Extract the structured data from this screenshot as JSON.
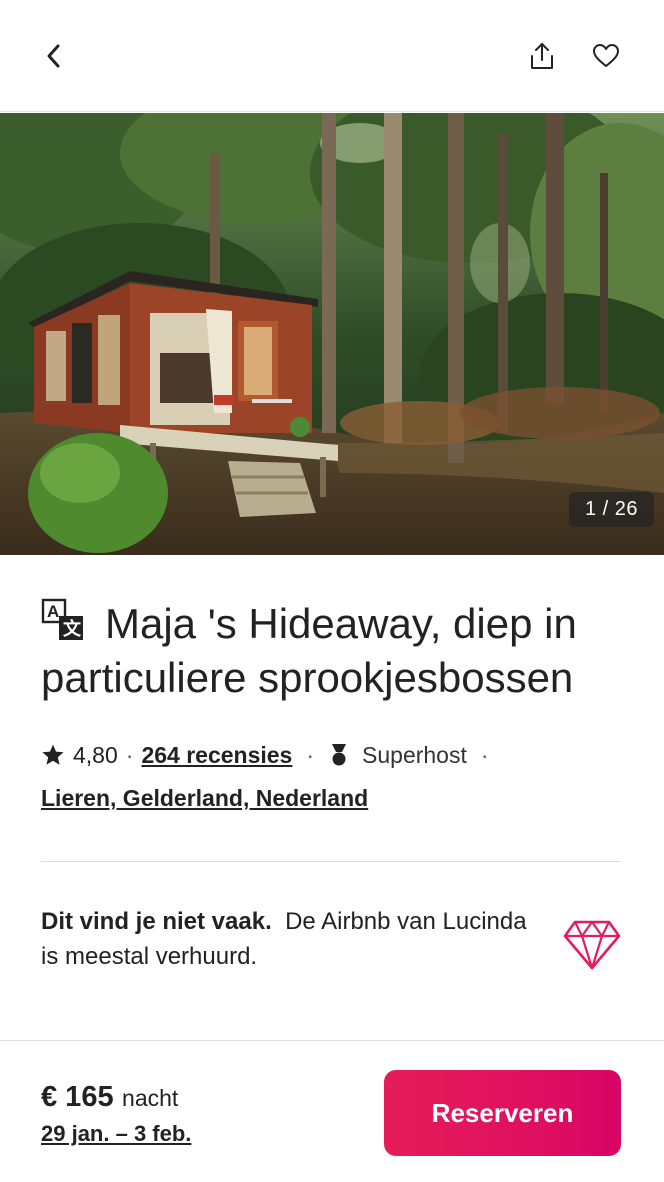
{
  "header": {
    "back_icon": "chevron-left-icon",
    "share_icon": "share-icon",
    "save_icon": "heart-icon"
  },
  "gallery": {
    "counter": "1 / 26",
    "image_description": "tiny-cabin-in-forest"
  },
  "listing": {
    "title": "Maja 's Hideaway, diep in particuliere sprookjesbossen",
    "translate_icon": "translate-icon",
    "rating": "4,80",
    "separator": "·",
    "reviews_label": "264 recensies",
    "superhost_label": "Superhost",
    "location": "Lieren, Gelderland, Nederland"
  },
  "highlight": {
    "bold": "Dit vind je niet vaak.",
    "text": "De Airbnb van Lucinda is meestal verhuurd.",
    "icon": "diamond-icon"
  },
  "footer": {
    "price": "€ 165",
    "per_label": "nacht",
    "dates": "29 jan. – 3 feb.",
    "reserve_label": "Reserveren"
  },
  "colors": {
    "brand": "#E31C5F",
    "text": "#222222",
    "divider": "#DDDDDD"
  }
}
